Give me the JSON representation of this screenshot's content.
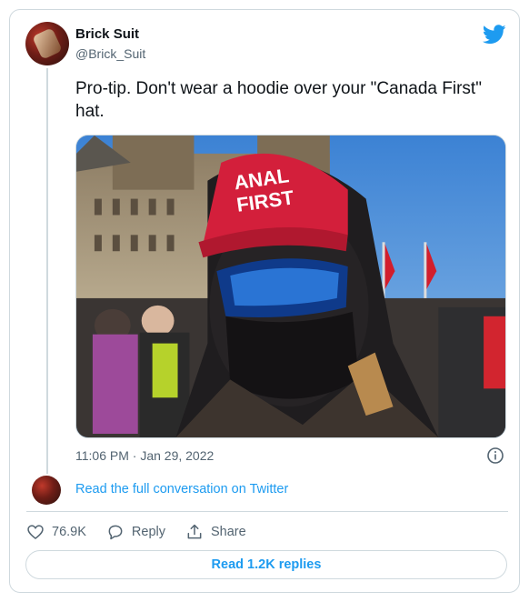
{
  "tweet": {
    "author_name": "Brick Suit",
    "author_handle": "@Brick_Suit",
    "text": "Pro-tip. Don't wear a hoodie over your \"Canada First\" hat.",
    "hat_text_line1": "ANAL",
    "hat_text_line2": "FIRST",
    "timestamp": "11:06 PM · Jan 29, 2022"
  },
  "conversation": {
    "link_label": "Read the full conversation on Twitter"
  },
  "actions": {
    "like_count": "76.9K",
    "reply_label": "Reply",
    "share_label": "Share"
  },
  "replies_button": {
    "label": "Read 1.2K replies"
  },
  "colors": {
    "twitter_blue": "#1d9bf0",
    "hat_red": "#d31f3b",
    "sky_blue": "#4d8fd8"
  },
  "icons": [
    "twitter-bird-icon",
    "info-icon",
    "heart-icon",
    "reply-icon",
    "share-icon"
  ]
}
